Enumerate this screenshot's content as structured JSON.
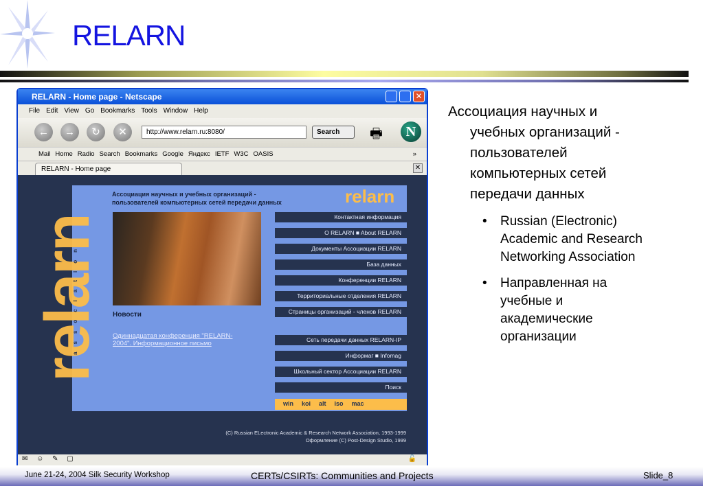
{
  "slide": {
    "title": "RELARN",
    "footer_left": "June 21-24, 2004 Silk Security Workshop",
    "footer_center": "CERTs/CSIRTs: Communities and Projects",
    "footer_right": "Slide_8"
  },
  "browser": {
    "window_title": "RELARN - Home page - Netscape",
    "menu": [
      "File",
      "Edit",
      "View",
      "Go",
      "Bookmarks",
      "Tools",
      "Window",
      "Help"
    ],
    "url": "http://www.relarn.ru:8080/",
    "search_label": "Search",
    "personal_toolbar": [
      "Mail",
      "Home",
      "Radio",
      "Search",
      "Bookmarks",
      "Google",
      "Яндекс",
      "IETF",
      "W3C",
      "OASIS"
    ],
    "more": "»",
    "tab_label": "RELARN - Home page"
  },
  "page": {
    "headline_1": "Ассоциация научных и учебных организаций -",
    "headline_2": "пользователей компьютерных сетей передачи данных",
    "logo": "relarn",
    "big_word": "relarn",
    "strip": "association",
    "news_heading": "Новости",
    "news_link": "Одиннадцатая конференция \"RELARN-2004\". Информационное письмо",
    "menu": [
      "Контактная информация",
      "О RELARN  ■  About RELARN",
      "Документы Ассоциации RELARN",
      "База данных",
      "Конференции RELARN",
      "Территориальные отделения RELARN",
      "Страницы организаций - членов RELARN",
      "Сеть передачи данных RELARN-IP",
      "Информаг  ■  Infomag",
      "Школьный сектор Ассоциации RELARN",
      "Поиск"
    ],
    "encodings": [
      "win",
      "koi",
      "alt",
      "iso",
      "mac"
    ],
    "copyright_1": "(C) Russian ELectronic Academic & Research Network Association, 1993-1999",
    "copyright_2": "Оформление (C) Post-Design Studio, 1999"
  },
  "side": {
    "heading_1": "Ассоциация научных и",
    "heading_rest": [
      "учебных организаций -",
      "пользователей",
      "компьютерных сетей",
      "передачи данных"
    ],
    "bullets": [
      "Russian (Electronic) Academic and Research Networking Association",
      "Направленная на учебные и академические организации"
    ]
  }
}
